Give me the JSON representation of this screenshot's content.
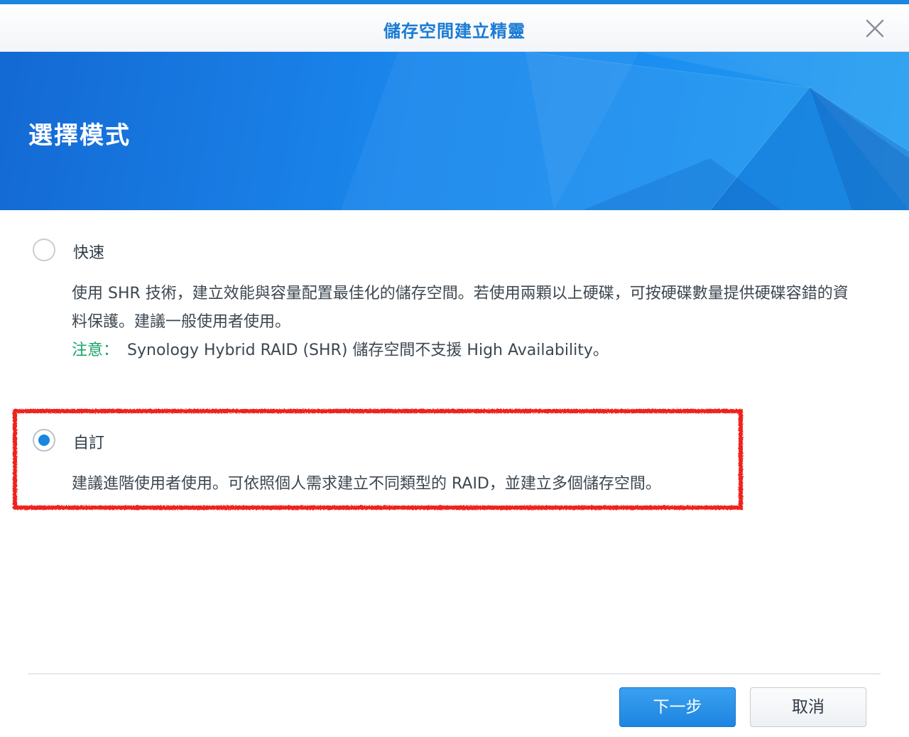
{
  "window": {
    "title": "儲存空間建立精靈",
    "close_icon": "close-icon"
  },
  "banner": {
    "title": "選擇模式"
  },
  "options": [
    {
      "label": "快速",
      "selected": false,
      "description": "使用 SHR 技術，建立效能與容量配置最佳化的儲存空間。若使用兩顆以上硬碟，可按硬碟數量提供硬碟容錯的資料保護。建議一般使用者使用。",
      "note_label": "注意：",
      "note_text": "Synology Hybrid RAID (SHR) 儲存空間不支援 High Availability。"
    },
    {
      "label": "自訂",
      "selected": true,
      "description": "建議進階使用者使用。可依照個人需求建立不同類型的 RAID，並建立多個儲存空間。"
    }
  ],
  "footer": {
    "next_label": "下一步",
    "cancel_label": "取消"
  },
  "colors": {
    "accent": "#1a86e0",
    "title": "#1a7bd4",
    "note": "#1aa36a",
    "highlight": "#f0211a"
  }
}
